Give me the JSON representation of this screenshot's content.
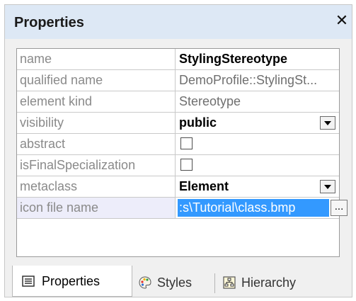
{
  "panel": {
    "title": "Properties",
    "close_glyph": "✕"
  },
  "properties": [
    {
      "name": "name",
      "value": "StylingStereotype"
    },
    {
      "name": "qualified name",
      "value": "DemoProfile::StylingSt..."
    },
    {
      "name": "element kind",
      "value": "Stereotype"
    },
    {
      "name": "visibility",
      "value": "public"
    },
    {
      "name": "abstract",
      "value": ""
    },
    {
      "name": "isFinalSpecialization",
      "value": ""
    },
    {
      "name": "metaclass",
      "value": "Element"
    },
    {
      "name": "icon file name",
      "value": ":s\\Tutorial\\class.bmp",
      "button": "..."
    }
  ],
  "tabs": [
    {
      "label": "Properties",
      "icon": "properties-list-icon",
      "active": true
    },
    {
      "label": "Styles",
      "icon": "palette-icon",
      "active": false
    },
    {
      "label": "Hierarchy",
      "icon": "hierarchy-icon",
      "active": false
    }
  ],
  "colors": {
    "title_background": "#dde8f5",
    "selection": "#3399ff",
    "selected_row": "#ededfa"
  }
}
